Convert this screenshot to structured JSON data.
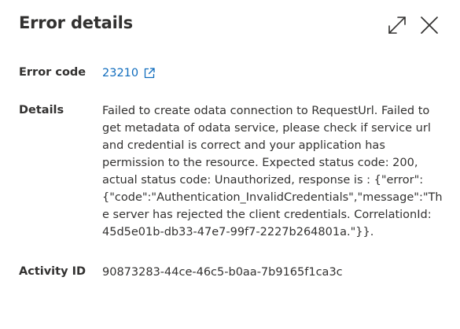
{
  "panel": {
    "title": "Error details"
  },
  "icons": {
    "expand": "expand-icon",
    "close": "close-icon",
    "external_link": "open-in-new-window-icon"
  },
  "rows": {
    "error_code": {
      "label": "Error code",
      "value": "23210"
    },
    "details": {
      "label": "Details",
      "value": "Failed to create odata connection to RequestUrl. Failed to\nget metadata of odata service, please check if service url\nand credential is correct and your application has\npermission to the resource. Expected status code: 200,\nactual status code: Unauthorized, response is : {\"error\":\n{\"code\":\"Authentication_InvalidCredentials\",\"message\":\"Th\ne server has rejected the client credentials. CorrelationId:\n45d5e01b-db33-47e7-99f7-2227b264801a.\"}}."
    },
    "activity_id": {
      "label": "Activity ID",
      "value": "90873283-44ce-46c5-b0aa-7b9165f1ca3c"
    }
  },
  "colors": {
    "link": "#0f6cbd",
    "text": "#323130"
  }
}
